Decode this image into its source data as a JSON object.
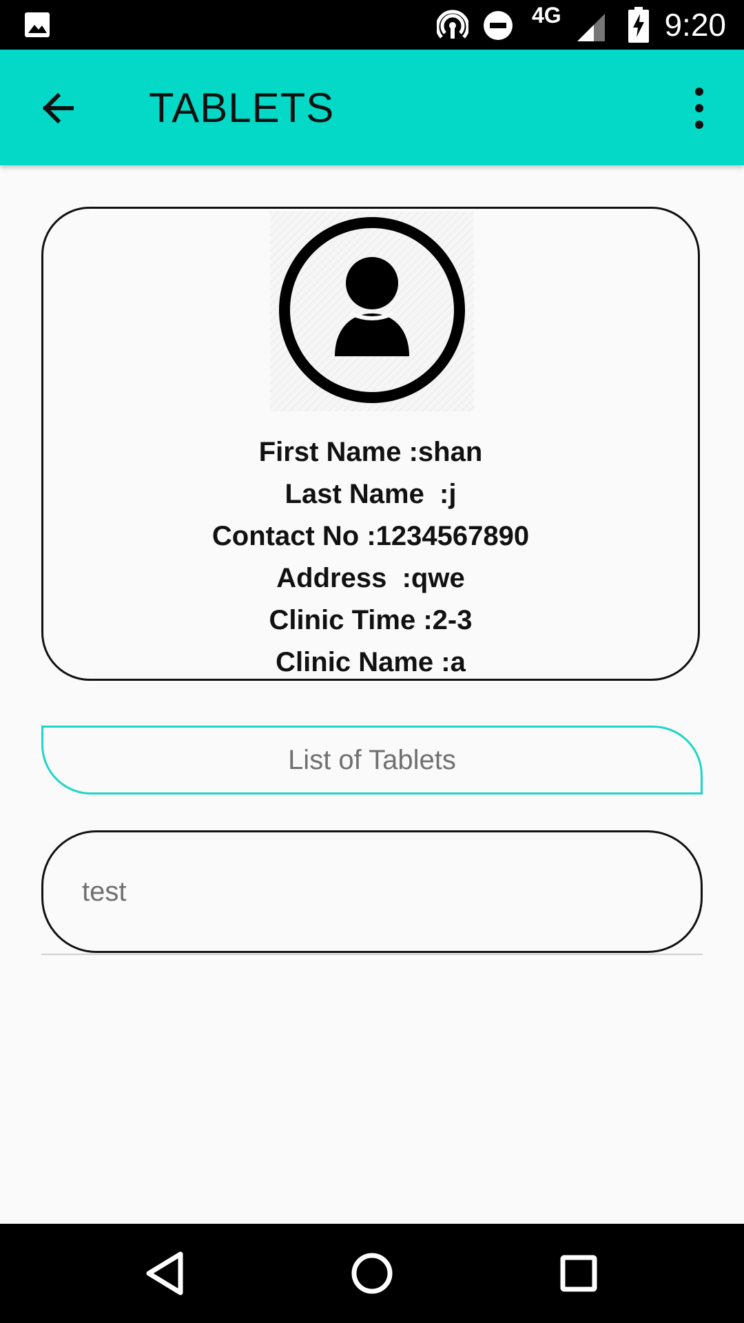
{
  "status_bar": {
    "time": "9:20",
    "network": "4G",
    "icons": [
      "image-icon",
      "hotspot-icon",
      "do-not-disturb-icon",
      "signal-icon",
      "battery-charging-icon"
    ]
  },
  "app_bar": {
    "title": "TABLETS",
    "back_icon": "arrow-back-icon",
    "menu_icon": "more-vert-icon",
    "color": "#03d9c6"
  },
  "profile": {
    "avatar_icon": "account-circle-icon",
    "first_name": "First Name :shan",
    "last_name": "Last Name  :j",
    "contact_no": "Contact No :1234567890",
    "address": "Address  :qwe",
    "clinic_time": "Clinic Time :2-3",
    "clinic_name": "Clinic Name :a"
  },
  "list": {
    "header_label": "List of Tablets",
    "accent_color": "#1ed6c8"
  },
  "input": {
    "value": "test"
  },
  "nav_bar": {
    "icons": [
      "nav-back-icon",
      "nav-home-icon",
      "nav-recents-icon"
    ]
  }
}
